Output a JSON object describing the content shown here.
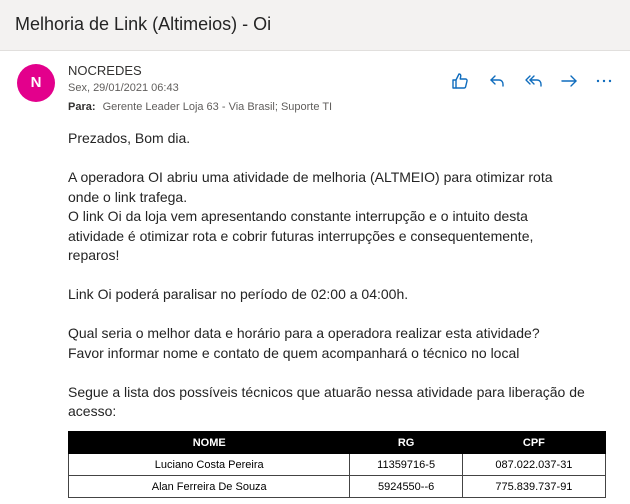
{
  "email": {
    "subject": "Melhoria de Link (Altimeios) - Oi",
    "avatar_initial": "N",
    "avatar_color": "#e3008c",
    "sender": "NOCREDES",
    "date": "Sex, 29/01/2021 06:43",
    "to_label": "Para:",
    "to_value": "Gerente Leader Loja 63 - Via Brasil; Suporte TI",
    "accent_color": "#0f6cbd"
  },
  "actions": {
    "like": "like-icon",
    "reply": "reply-icon",
    "reply_all": "reply-all-icon",
    "forward": "forward-icon",
    "more": "more-icon"
  },
  "body": {
    "greeting": "Prezados, Bom dia.",
    "para1_line1": "A operadora OI abriu uma atividade de melhoria (ALTMEIO) para otimizar rota",
    "para1_line2": "onde o link trafega.",
    "para2_line1": "O link Oi da loja vem apresentando constante interrupção e o intuito desta",
    "para2_line2": "atividade é otimizar rota e cobrir futuras interrupções e consequentemente,",
    "para2_line3": "reparos!",
    "para3": "Link Oi poderá paralisar no período de 02:00 a 04:00h.",
    "para4_line1": "Qual seria o melhor data e horário para a operadora realizar esta atividade?",
    "para4_line2": "Favor informar nome e contato de quem acompanhará o técnico no local",
    "para5_line1": "Segue a lista dos possíveis técnicos que atuarão nessa atividade para liberação de",
    "para5_line2": "acesso:"
  },
  "table": {
    "headers": [
      "NOME",
      "RG",
      "CPF"
    ],
    "rows": [
      [
        "Luciano Costa Pereira",
        "11359716-5",
        "087.022.037-31"
      ],
      [
        "Alan Ferreira De Souza",
        "5924550--6",
        "775.839.737-91"
      ]
    ]
  }
}
